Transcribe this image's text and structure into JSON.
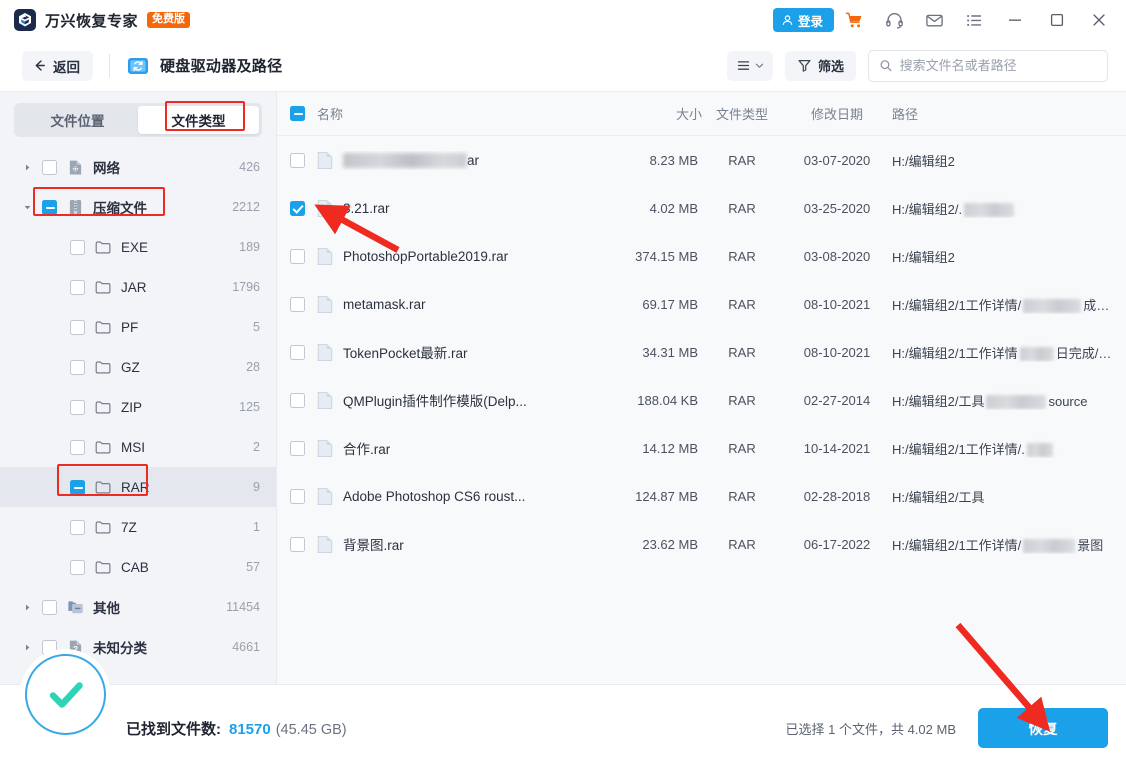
{
  "app": {
    "brand_name": "万兴恢复专家",
    "brand_badge": "免费版",
    "login_label": "登录"
  },
  "titlebar_icons": [
    "cart-icon",
    "headset-icon",
    "mail-icon",
    "menu-list-icon",
    "minimize-icon",
    "maximize-icon",
    "close-icon"
  ],
  "toolbar": {
    "back_label": "返回",
    "page_title": "硬盘驱动器及路径",
    "filter_label": "筛选",
    "search_placeholder": "搜索文件名或者路径",
    "search_value": ""
  },
  "sidebar": {
    "tabs": [
      {
        "label": "文件位置",
        "active": false
      },
      {
        "label": "文件类型",
        "active": true
      }
    ],
    "tree": [
      {
        "label": "网络",
        "count": "426",
        "icon": "network-file-icon",
        "state": "unchecked",
        "indent": 0,
        "caret": "collapsed",
        "selected": false
      },
      {
        "label": "压缩文件",
        "count": "2212",
        "icon": "archive-icon",
        "state": "indeterminate",
        "indent": 0,
        "caret": "expanded",
        "selected": false
      },
      {
        "label": "EXE",
        "count": "189",
        "icon": "folder-icon",
        "state": "unchecked",
        "indent": 1,
        "caret": "none",
        "selected": false
      },
      {
        "label": "JAR",
        "count": "1796",
        "icon": "folder-icon",
        "state": "unchecked",
        "indent": 1,
        "caret": "none",
        "selected": false
      },
      {
        "label": "PF",
        "count": "5",
        "icon": "folder-icon",
        "state": "unchecked",
        "indent": 1,
        "caret": "none",
        "selected": false
      },
      {
        "label": "GZ",
        "count": "28",
        "icon": "folder-icon",
        "state": "unchecked",
        "indent": 1,
        "caret": "none",
        "selected": false
      },
      {
        "label": "ZIP",
        "count": "125",
        "icon": "folder-icon",
        "state": "unchecked",
        "indent": 1,
        "caret": "none",
        "selected": false
      },
      {
        "label": "MSI",
        "count": "2",
        "icon": "folder-icon",
        "state": "unchecked",
        "indent": 1,
        "caret": "none",
        "selected": false
      },
      {
        "label": "RAR",
        "count": "9",
        "icon": "folder-icon",
        "state": "indeterminate",
        "indent": 1,
        "caret": "none",
        "selected": true
      },
      {
        "label": "7Z",
        "count": "1",
        "icon": "folder-icon",
        "state": "unchecked",
        "indent": 1,
        "caret": "none",
        "selected": false
      },
      {
        "label": "CAB",
        "count": "57",
        "icon": "folder-icon",
        "state": "unchecked",
        "indent": 1,
        "caret": "none",
        "selected": false
      },
      {
        "label": "其他",
        "count": "11454",
        "icon": "other-file-icon",
        "state": "unchecked",
        "indent": 0,
        "caret": "collapsed",
        "selected": false
      },
      {
        "label": "未知分类",
        "count": "4661",
        "icon": "unknown-file-icon",
        "state": "unchecked",
        "indent": 0,
        "caret": "collapsed",
        "selected": false
      }
    ]
  },
  "table": {
    "header_state": "indeterminate",
    "columns": {
      "name": "名称",
      "size": "大小",
      "type": "文件类型",
      "date": "修改日期",
      "path": "路径"
    },
    "rows": [
      {
        "checked": false,
        "name": "ar",
        "name_blurred_width": 124,
        "size": "8.23 MB",
        "type": "RAR",
        "date": "03-07-2020",
        "path": "H:/编辑组2",
        "path_blur_width": 0
      },
      {
        "checked": true,
        "name": "3.21.rar",
        "name_blurred_width": 0,
        "size": "4.02 MB",
        "type": "RAR",
        "date": "03-25-2020",
        "path": "H:/编辑组2/.",
        "path_blur_width": 50
      },
      {
        "checked": false,
        "name": "PhotoshopPortable2019.rar",
        "name_blurred_width": 0,
        "size": "374.15 MB",
        "type": "RAR",
        "date": "03-08-2020",
        "path": "H:/编辑组2",
        "path_blur_width": 0
      },
      {
        "checked": false,
        "name": "metamask.rar",
        "name_blurred_width": 0,
        "size": "69.17 MB",
        "type": "RAR",
        "date": "08-10-2021",
        "path": "H:/编辑组2/1工作详情/",
        "path_suffix": "成/软件...",
        "path_blur_width": 58
      },
      {
        "checked": false,
        "name": "TokenPocket最新.rar",
        "name_blurred_width": 0,
        "size": "34.31 MB",
        "type": "RAR",
        "date": "08-10-2021",
        "path": "H:/编辑组2/1工作详情",
        "path_suffix": "日完成/软件...",
        "path_blur_width": 34
      },
      {
        "checked": false,
        "name": "QMPlugin插件制作模版(Delp...",
        "name_blurred_width": 0,
        "size": "188.04 KB",
        "type": "RAR",
        "date": "02-27-2014",
        "path": "H:/编辑组2/工具",
        "path_suffix": "source",
        "path_blur_width": 60
      },
      {
        "checked": false,
        "name": "合作.rar",
        "name_blurred_width": 0,
        "size": "14.12 MB",
        "type": "RAR",
        "date": "10-14-2021",
        "path": "H:/编辑组2/1工作详情/.",
        "path_blur_width": 26
      },
      {
        "checked": false,
        "name": "Adobe Photoshop CS6  roust...",
        "name_blurred_width": 0,
        "size": "124.87 MB",
        "type": "RAR",
        "date": "02-28-2018",
        "path": "H:/编辑组2/工具",
        "path_blur_width": 0
      },
      {
        "checked": false,
        "name": "背景图.rar",
        "name_blurred_width": 0,
        "size": "23.62 MB",
        "type": "RAR",
        "date": "06-17-2022",
        "path": "H:/编辑组2/1工作详情/",
        "path_suffix": "景图",
        "path_blur_width": 52
      }
    ]
  },
  "footer": {
    "found_label": "已找到文件数:",
    "found_count": "81570",
    "found_size": "(45.45 GB)",
    "selection_text": "已选择 1 个文件，共 4.02 MB",
    "recover_label": "恢复",
    "status_icon": "green-check-circle-icon"
  },
  "colors": {
    "accent_blue": "#1ba1ea",
    "badge_orange": "#f4670a",
    "annotation_red": "#ef2b21",
    "check_green": "#2fd3b6"
  }
}
